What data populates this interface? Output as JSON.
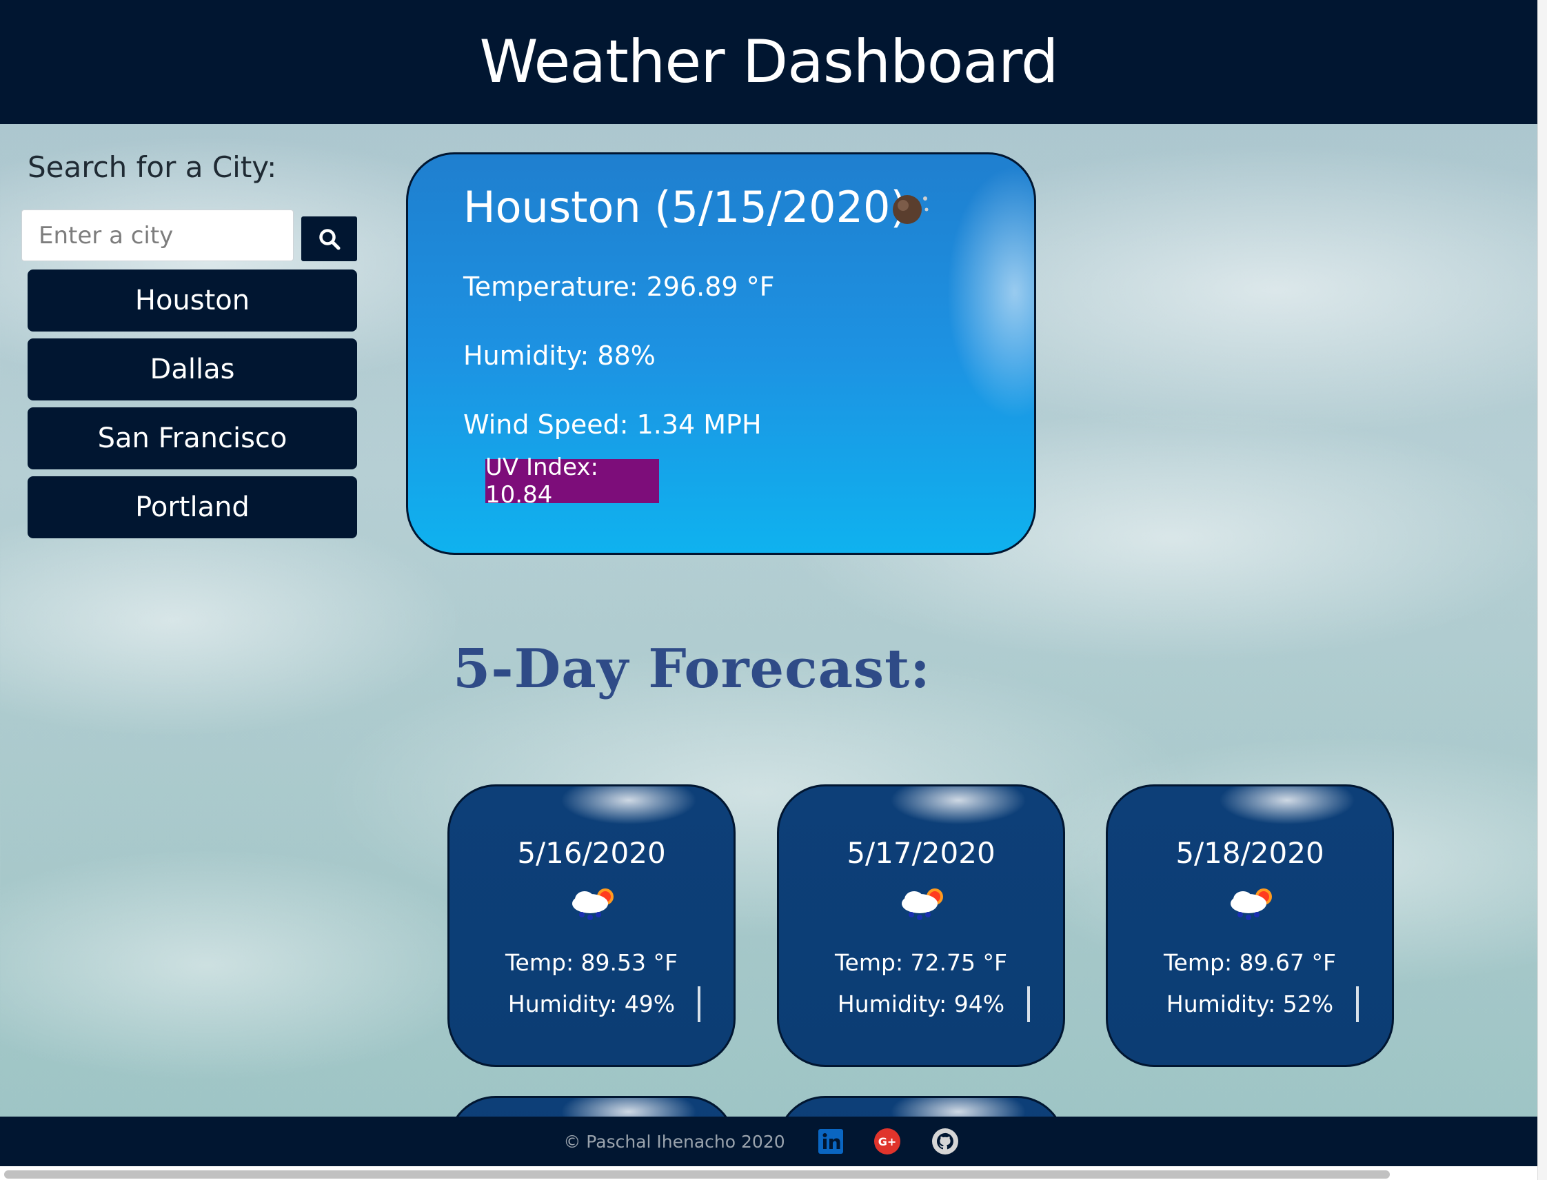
{
  "header": {
    "title": "Weather Dashboard"
  },
  "sidebar": {
    "label": "Search for a City:",
    "search": {
      "placeholder": "Enter a city",
      "value": ""
    },
    "cities": [
      "Houston",
      "Dallas",
      "San Francisco",
      "Portland"
    ]
  },
  "current": {
    "title": "Houston (5/15/2020)",
    "icon": "night-moon-icon",
    "temperature": "Temperature: 296.89 °F",
    "humidity": "Humidity: 88%",
    "wind": "Wind Speed: 1.34 MPH",
    "uv": "UV Index: 10.84"
  },
  "forecast": {
    "heading": "5-Day Forecast:",
    "days": [
      {
        "date": "5/16/2020",
        "icon": "rain-sun-cloud-icon",
        "temp": "Temp: 89.53 °F",
        "humidity": "Humidity: 49%"
      },
      {
        "date": "5/17/2020",
        "icon": "rain-sun-cloud-icon",
        "temp": "Temp: 72.75 °F",
        "humidity": "Humidity: 94%"
      },
      {
        "date": "5/18/2020",
        "icon": "rain-sun-cloud-icon",
        "temp": "Temp: 89.67 °F",
        "humidity": "Humidity: 52%"
      }
    ]
  },
  "footer": {
    "copyright": "© Paschal Ihenacho 2020",
    "links": [
      "linkedin-icon",
      "google-plus-icon",
      "github-icon"
    ]
  },
  "colors": {
    "navy": "#011631",
    "uv_badge": "#7d0d7a",
    "forecast_heading": "#2f4b87"
  }
}
